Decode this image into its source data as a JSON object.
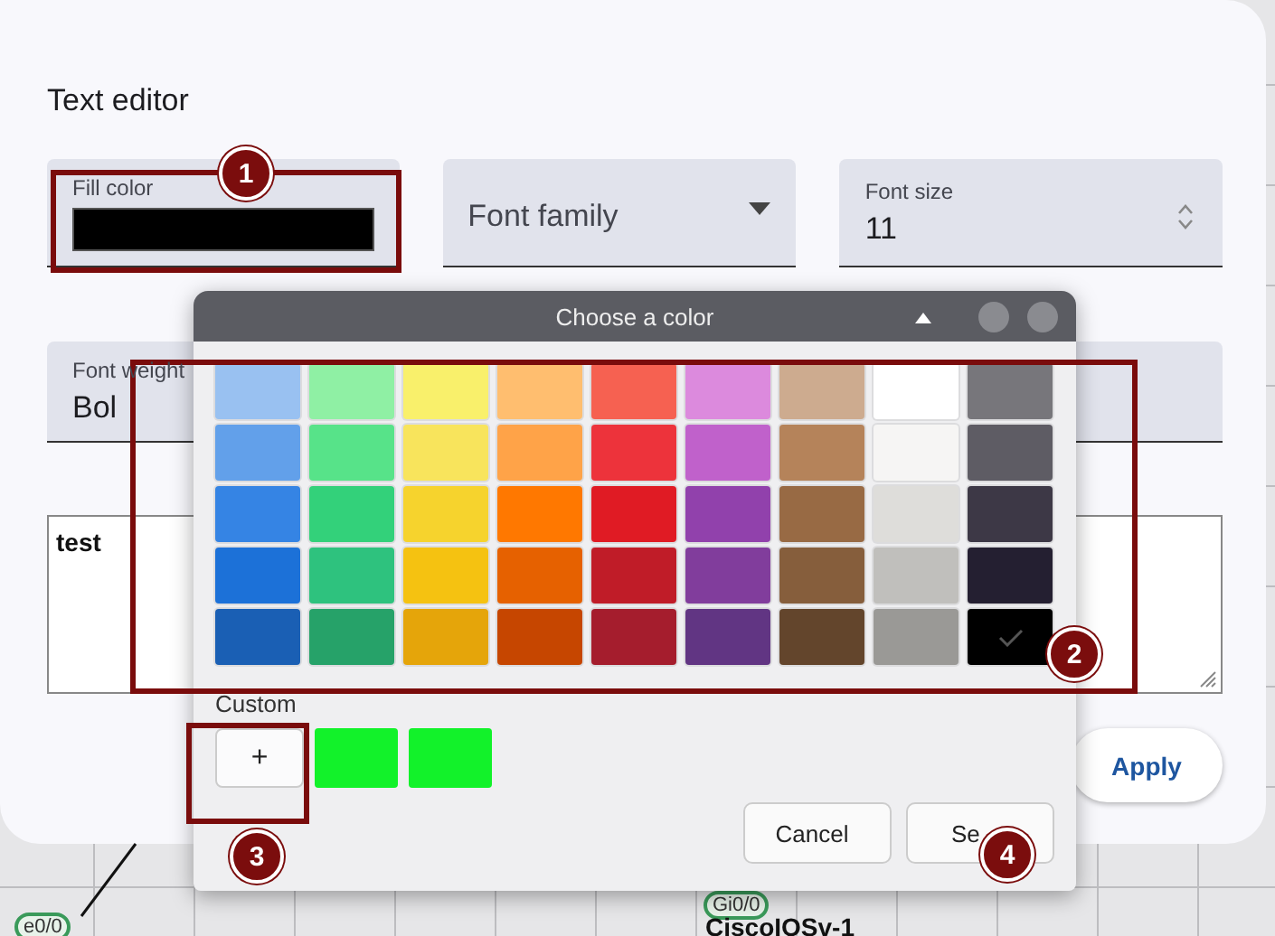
{
  "text_editor": {
    "title": "Text editor",
    "fill_color": {
      "label": "Fill color",
      "color": "#000000"
    },
    "font_family": {
      "placeholder": "Font family"
    },
    "font_size": {
      "label": "Font size",
      "value": "11"
    },
    "font_weight": {
      "label": "Font weight",
      "value": "Bol"
    },
    "text": {
      "value": "test"
    },
    "apply_button": "Apply"
  },
  "canvas": {
    "nodes": [
      {
        "kind": "port",
        "label": "e0/0"
      },
      {
        "kind": "port",
        "label": "Gi0/0"
      },
      {
        "kind": "device",
        "label": "CiscoIOSv-1"
      }
    ]
  },
  "color_dialog": {
    "title": "Choose a color",
    "palette": [
      [
        {
          "color": "#99c1f1",
          "selected": false
        },
        {
          "color": "#8ff0a4",
          "selected": false
        },
        {
          "color": "#f9f06b",
          "selected": false
        },
        {
          "color": "#ffbe6f",
          "selected": false
        },
        {
          "color": "#f66151",
          "selected": false
        },
        {
          "color": "#dc8add",
          "selected": false
        },
        {
          "color": "#cdab8f",
          "selected": false
        },
        {
          "color": "#ffffff",
          "selected": false
        },
        {
          "color": "#77767b",
          "selected": false
        }
      ],
      [
        {
          "color": "#62a0ea",
          "selected": false
        },
        {
          "color": "#57e389",
          "selected": false
        },
        {
          "color": "#f8e45c",
          "selected": false
        },
        {
          "color": "#ffa348",
          "selected": false
        },
        {
          "color": "#ed333b",
          "selected": false
        },
        {
          "color": "#c061cb",
          "selected": false
        },
        {
          "color": "#b5835a",
          "selected": false
        },
        {
          "color": "#f6f5f4",
          "selected": false
        },
        {
          "color": "#5e5c64",
          "selected": false
        }
      ],
      [
        {
          "color": "#3584e4",
          "selected": false
        },
        {
          "color": "#33d17a",
          "selected": false
        },
        {
          "color": "#f6d32d",
          "selected": false
        },
        {
          "color": "#ff7800",
          "selected": false
        },
        {
          "color": "#e01b24",
          "selected": false
        },
        {
          "color": "#9141ac",
          "selected": false
        },
        {
          "color": "#986a44",
          "selected": false
        },
        {
          "color": "#deddda",
          "selected": false
        },
        {
          "color": "#3d3846",
          "selected": false
        }
      ],
      [
        {
          "color": "#1c71d8",
          "selected": false
        },
        {
          "color": "#2ec27e",
          "selected": false
        },
        {
          "color": "#f5c211",
          "selected": false
        },
        {
          "color": "#e66100",
          "selected": false
        },
        {
          "color": "#c01c28",
          "selected": false
        },
        {
          "color": "#813d9c",
          "selected": false
        },
        {
          "color": "#865e3c",
          "selected": false
        },
        {
          "color": "#c0bfbc",
          "selected": false
        },
        {
          "color": "#241f31",
          "selected": false
        }
      ],
      [
        {
          "color": "#1a5fb4",
          "selected": false
        },
        {
          "color": "#26a269",
          "selected": false
        },
        {
          "color": "#e5a50a",
          "selected": false
        },
        {
          "color": "#c64600",
          "selected": false
        },
        {
          "color": "#a51d2d",
          "selected": false
        },
        {
          "color": "#613583",
          "selected": false
        },
        {
          "color": "#63452c",
          "selected": false
        },
        {
          "color": "#9a9996",
          "selected": false
        },
        {
          "color": "#000000",
          "selected": true
        }
      ]
    ],
    "custom_label": "Custom",
    "add_button": "+",
    "custom_colors": [
      {
        "color": "#12f22a"
      },
      {
        "color": "#12f22a"
      }
    ],
    "buttons": [
      "Cancel",
      "Se"
    ]
  },
  "annotations": [
    {
      "number": "1"
    },
    {
      "number": "2"
    },
    {
      "number": "3"
    },
    {
      "number": "4"
    }
  ]
}
